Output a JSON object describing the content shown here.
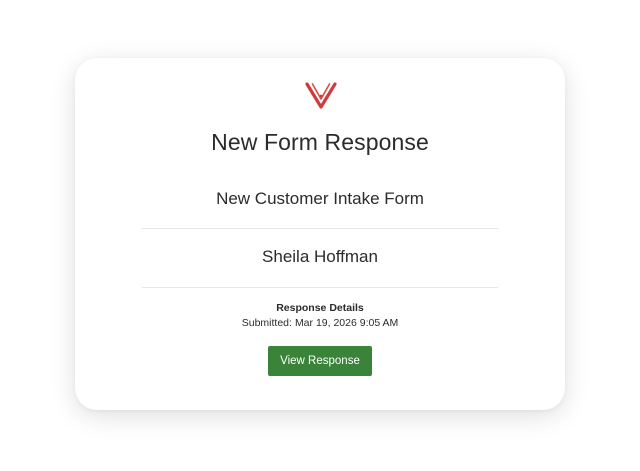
{
  "brand": {
    "logo_icon": "v-brand-logo-icon",
    "logo_color": "#d23a3a"
  },
  "email": {
    "title": "New Form Response",
    "form_name": "New Customer Intake Form",
    "respondent_name": "Sheila Hoffman",
    "details_heading": "Response Details",
    "submitted_label": "Submitted:",
    "submitted_value": "Mar 19, 2026 9:05 AM",
    "view_button_label": "View Response",
    "button_color": "#3a843a"
  }
}
